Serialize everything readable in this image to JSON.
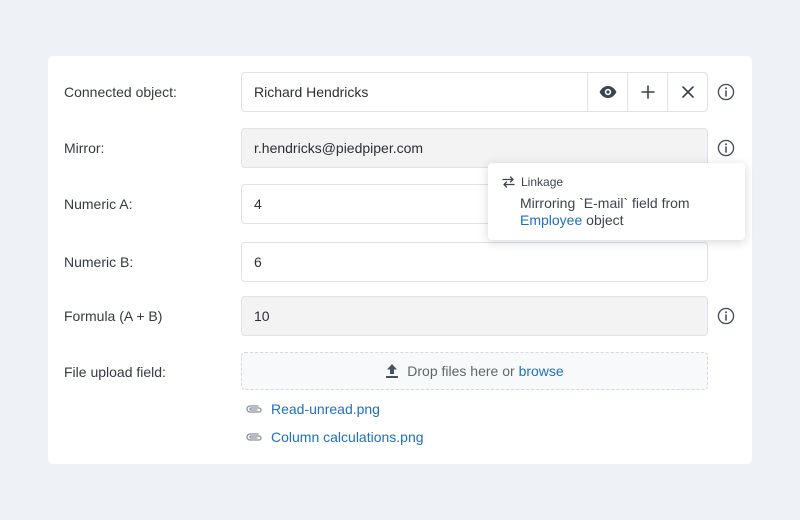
{
  "form": {
    "connected_object": {
      "label": "Connected object:",
      "value": "Richard Hendricks",
      "actions": [
        "eye-icon",
        "plus-icon",
        "close-icon"
      ]
    },
    "mirror": {
      "label": "Mirror:",
      "value": "r.hendricks@piedpiper.com"
    },
    "numeric_a": {
      "label": "Numeric A:",
      "value": "4"
    },
    "numeric_b": {
      "label": "Numeric B:",
      "value": "6"
    },
    "formula": {
      "label": "Formula (A + B)",
      "value": "10"
    },
    "file_upload": {
      "label": "File upload field:",
      "drop_text": "Drop files here or",
      "browse_link": "browse",
      "files": [
        {
          "name": "Read-unread.png"
        },
        {
          "name": "Column calculations.png"
        }
      ]
    }
  },
  "tooltip": {
    "title": "Linkage",
    "text_before": "Mirroring `E-mail` field from",
    "link": "Employee",
    "text_after": "object"
  },
  "colors": {
    "page_bg": "#eef1f5",
    "card_bg": "#ffffff",
    "readonly_bg": "#f3f3f3",
    "link": "#1e6fbf",
    "icon": "#4a5260"
  }
}
